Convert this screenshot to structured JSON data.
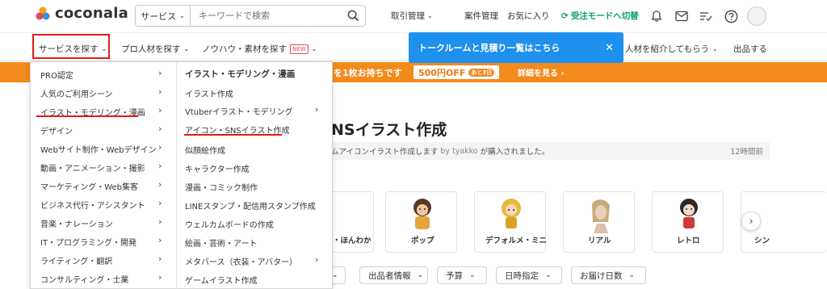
{
  "header": {
    "logo_text": "coconala",
    "search": {
      "category": "サービス",
      "placeholder": "キーワードで検索"
    },
    "nav": [
      "取引管理",
      "案件管理",
      "お気に入り"
    ],
    "mode_switch": "受注モードへ切替",
    "colors": {
      "brand_orange": "#f28a1c",
      "accent_green": "#0aa06e",
      "tooltip_blue": "#1e90ee",
      "highlight_red": "#e01b1b"
    }
  },
  "subnav": {
    "items": [
      "サービスを探す",
      "プロ人材を探す",
      "ノウハウ・素材を探す"
    ],
    "new_badge": "NEW",
    "right_items": [
      "人材を紹介してもらう",
      "出品する"
    ]
  },
  "tooltip": {
    "text": "トークルームと見積り一覧はこちら"
  },
  "banner": {
    "text": "を1枚お持ちです",
    "badge": "500円OFF",
    "badge_sub": "あと3日",
    "link": "詳細を見る"
  },
  "dropdown": {
    "left": [
      "PRO認定",
      "人気のご利用シーン",
      "イラスト・モデリング・漫画",
      "デザイン",
      "Webサイト制作・Webデザイン",
      "動画・アニメーション・撮影",
      "マーケティング・Web集客",
      "ビジネス代行・アシスタント",
      "音楽・ナレーション",
      "IT・プログラミング・開発",
      "ライティング・翻訳",
      "コンサルティング・士業"
    ],
    "right_title": "イラスト・モデリング・漫画",
    "right": [
      "イラスト作成",
      "Vtuberイラスト・モデリング",
      "アイコン・SNSイラスト作成",
      "似顔絵作成",
      "キャラクター作成",
      "漫画・コミック制作",
      "LINEスタンプ・配信用スタンプ作成",
      "ウェルカムボードの作成",
      "絵画・芸術・アート",
      "メタバース（衣装・アバター）",
      "ゲームイラスト作成"
    ]
  },
  "page": {
    "title": "NSイラスト作成",
    "notice": {
      "text": "ムアイコンイラスト作成します",
      "by": "by tyakko",
      "suffix": "が購入されました。",
      "time": "12時間前"
    },
    "styles": [
      "・ほんわか",
      "ポップ",
      "デフォルメ・ミニ",
      "リアル",
      "レトロ",
      "シン"
    ],
    "filters": [
      "出品者情報",
      "予算",
      "日時指定",
      "お届け日数"
    ]
  }
}
